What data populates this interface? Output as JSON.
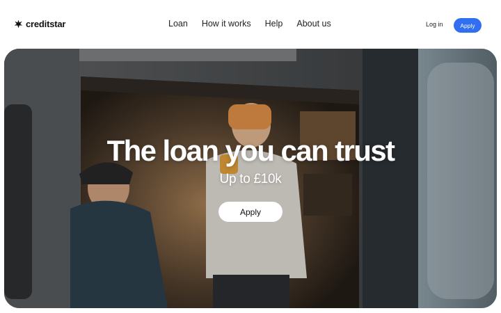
{
  "brand": {
    "name": "creditstar",
    "icon": "star-burst-icon"
  },
  "nav": {
    "items": [
      {
        "label": "Loan"
      },
      {
        "label": "How it works"
      },
      {
        "label": "Help"
      },
      {
        "label": "About us"
      }
    ]
  },
  "header": {
    "login_label": "Log in",
    "apply_label": "Apply"
  },
  "hero": {
    "title": "The loan you can trust",
    "subtitle": "Up to £10k",
    "cta_label": "Apply",
    "image": "photo of two people in a camper van"
  },
  "colors": {
    "accent": "#2f6ff0",
    "text": "#1c1c1c",
    "background": "#ffffff"
  }
}
